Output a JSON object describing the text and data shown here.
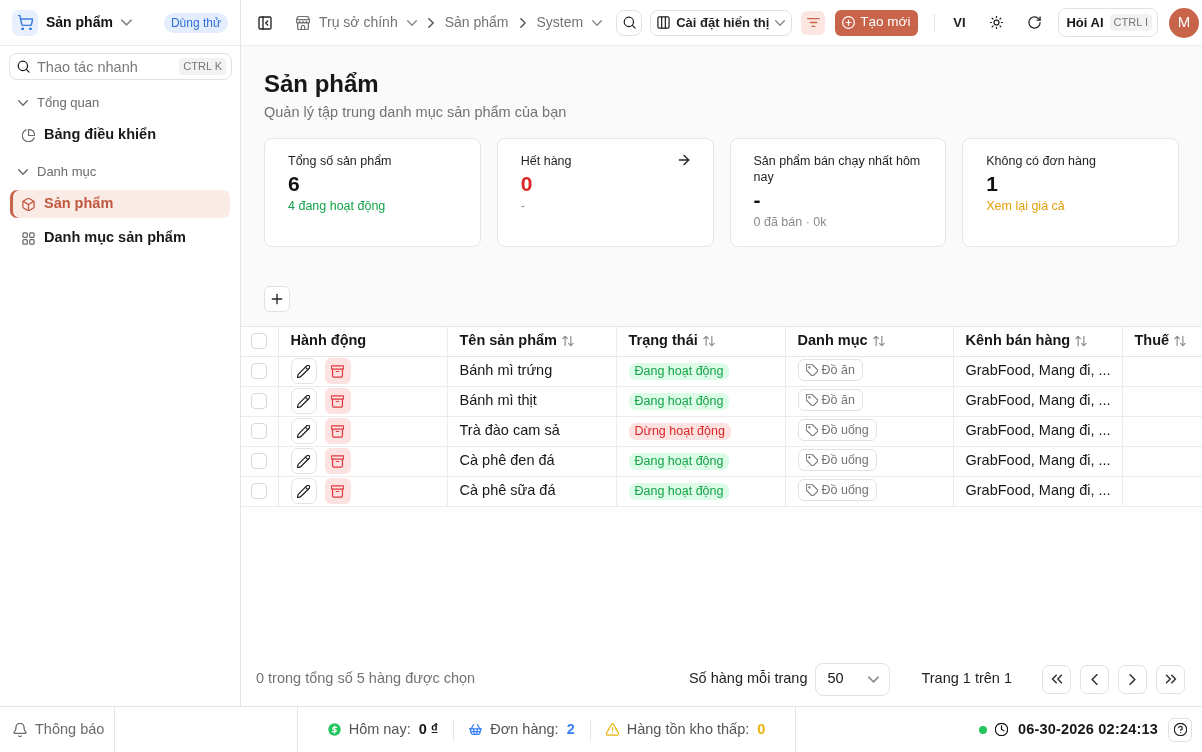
{
  "app": {
    "title": "Sản phẩm",
    "badge": "Dùng thử"
  },
  "sidebar": {
    "search": {
      "placeholder": "Thao tác nhanh",
      "shortcut": "CTRL K"
    },
    "groups": [
      {
        "label": "Tổng quan",
        "expanded": true,
        "items": [
          {
            "label": "Bảng điều khiển",
            "kind": "chart",
            "selected": false
          }
        ]
      },
      {
        "label": "Danh mục",
        "expanded": true,
        "items": [
          {
            "label": "Sản phẩm",
            "kind": "product",
            "selected": true
          },
          {
            "label": "Danh mục sản phẩm",
            "kind": "category",
            "selected": false
          }
        ]
      }
    ]
  },
  "header": {
    "breadcrumb": [
      {
        "label": "Trụ sở chính",
        "kind": "branch"
      },
      {
        "label": "Sản phẩm",
        "kind": "page"
      },
      {
        "label": "System",
        "kind": "menu"
      }
    ],
    "view_settings": "Cài đặt hiển thị",
    "create": "Tạo mới",
    "language": "VI",
    "ask_ai": {
      "label": "Hỏi AI",
      "shortcut": "CTRL I"
    },
    "avatar": "M"
  },
  "page": {
    "title": "Sản phẩm",
    "subtitle": "Quản lý tập trung danh mục sản phẩm của bạn"
  },
  "stats": [
    {
      "kind": "total",
      "label": "Tổng số sản phẩm",
      "value": "6",
      "note": "4 đang hoạt động",
      "link": false
    },
    {
      "kind": "out_of_stock",
      "label": "Hết hàng",
      "value": "0",
      "note": "-",
      "link": true
    },
    {
      "kind": "best_seller",
      "label": "Sản phẩm bán chạy nhất hôm nay",
      "value": "-",
      "note": "0 đã bán · 0k",
      "link": false
    },
    {
      "kind": "no_orders",
      "label": "Không có đơn hàng",
      "value": "1",
      "note": "Xem lại giá cả",
      "link": false
    }
  ],
  "table": {
    "all_selected": false,
    "columns": [
      {
        "label": "Hành động",
        "sortable": false
      },
      {
        "label": "Tên sản phẩm",
        "sortable": true
      },
      {
        "label": "Trạng thái",
        "sortable": true
      },
      {
        "label": "Danh mục",
        "sortable": true
      },
      {
        "label": "Kênh bán hàng",
        "sortable": true
      },
      {
        "label": "Thuế",
        "sortable": true
      }
    ],
    "rows": [
      {
        "selected": false,
        "name": "Bánh mì trứng",
        "status": "Đang hoạt động",
        "active": true,
        "category": "Đồ ăn",
        "channels": "GrabFood, Mang đi, ..."
      },
      {
        "selected": false,
        "name": "Bánh mì thịt",
        "status": "Đang hoạt động",
        "active": true,
        "category": "Đồ ăn",
        "channels": "GrabFood, Mang đi, ..."
      },
      {
        "selected": false,
        "name": "Trà đào cam sả",
        "status": "Dừng hoạt động",
        "active": false,
        "category": "Đồ uống",
        "channels": "GrabFood, Mang đi, ..."
      },
      {
        "selected": false,
        "name": "Cà phê đen đá",
        "status": "Đang hoạt động",
        "active": true,
        "category": "Đồ uống",
        "channels": "GrabFood, Mang đi, ..."
      },
      {
        "selected": false,
        "name": "Cà phê sữa đá",
        "status": "Đang hoạt động",
        "active": true,
        "category": "Đồ uống",
        "channels": "GrabFood, Mang đi, ..."
      }
    ]
  },
  "pagination": {
    "selection_summary": "0 trong tổng số 5 hàng được chọn",
    "rows_per_page_label": "Số hàng mỗi trang",
    "rows_per_page": "50",
    "page_info": "Trang 1 trên 1"
  },
  "status_bar": {
    "notifications": "Thông báo",
    "metrics": [
      {
        "kind": "revenue",
        "label": "Hôm nay:",
        "value": "0 ₫"
      },
      {
        "kind": "orders",
        "label": "Đơn hàng:",
        "value": "2"
      },
      {
        "kind": "low_stock",
        "label": "Hàng tồn kho thấp:",
        "value": "0"
      }
    ],
    "online": true,
    "datetime": "06-30-2026 02:24:13"
  }
}
